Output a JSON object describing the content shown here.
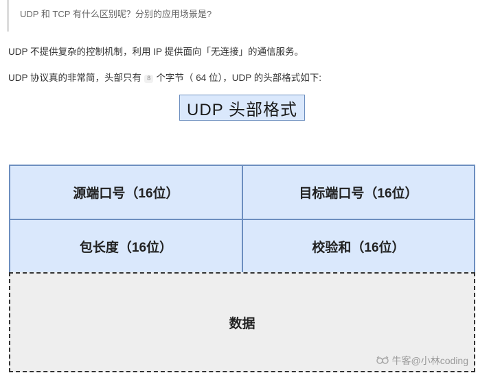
{
  "quote": {
    "text": "UDP 和 TCP 有什么区别呢？分别的应用场景是?"
  },
  "paragraphs": {
    "p1": "UDP 不提供复杂的控制机制，利用 IP 提供面向「无连接」的通信服务。",
    "p2_before": "UDP 协议真的非常简，头部只有",
    "p2_code": "8",
    "p2_after": "个字节（ 64 位），UDP 的头部格式如下:"
  },
  "diagram": {
    "title": "UDP 头部格式",
    "fields": {
      "source_port": "源端口号（16位）",
      "dest_port": "目标端口号（16位）",
      "length": "包长度（16位）",
      "checksum": "校验和（16位）",
      "data": "数据"
    },
    "colors": {
      "header_fill": "#dae8fc",
      "header_border": "#6c8ebf",
      "data_fill": "#eeeeee",
      "data_border": "#333333"
    }
  },
  "watermark": {
    "icon": "nowcoder-logo-icon",
    "text": "牛客@小林coding"
  }
}
